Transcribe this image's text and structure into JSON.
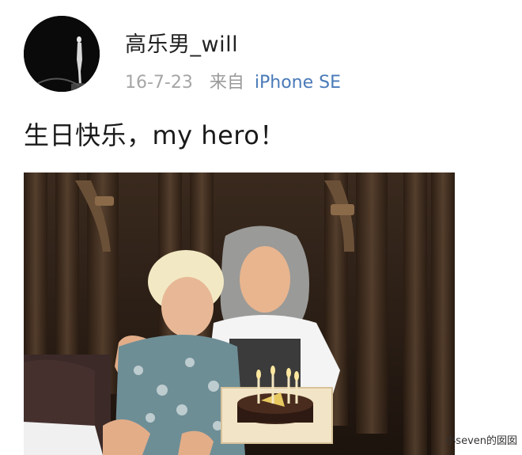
{
  "post": {
    "username": "高乐男_will",
    "date": "16-7-23",
    "from_label": "来自",
    "device": "iPhone SE",
    "text": "生日快乐，my hero！"
  },
  "watermark": "小seven的囡囡",
  "icons": {
    "avatar": "user-avatar-icon",
    "photo": "birthday-photo"
  },
  "colors": {
    "username": "#222222",
    "meta": "#a6a6a6",
    "device_link": "#4a7ab8",
    "text": "#1a1a1a"
  }
}
